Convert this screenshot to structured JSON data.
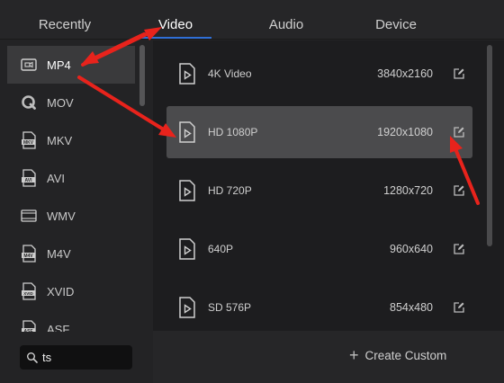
{
  "tabs": [
    {
      "label": "Recently"
    },
    {
      "label": "Video"
    },
    {
      "label": "Audio"
    },
    {
      "label": "Device"
    }
  ],
  "active_tab": "Video",
  "sidebar": {
    "items": [
      {
        "label": "MP4",
        "icon": "mp4-video-icon"
      },
      {
        "label": "MOV",
        "icon": "quicktime-icon"
      },
      {
        "label": "MKV",
        "icon": "mkv-file-icon"
      },
      {
        "label": "AVI",
        "icon": "avi-file-icon"
      },
      {
        "label": "WMV",
        "icon": "wmv-file-icon"
      },
      {
        "label": "M4V",
        "icon": "m4v-file-icon"
      },
      {
        "label": "XVID",
        "icon": "xvid-file-icon"
      },
      {
        "label": "ASF",
        "icon": "asf-file-icon"
      }
    ],
    "selected": "MP4"
  },
  "search": {
    "value": "ts"
  },
  "presets": [
    {
      "name": "4K Video",
      "resolution": "3840x2160"
    },
    {
      "name": "HD 1080P",
      "resolution": "1920x1080"
    },
    {
      "name": "HD 720P",
      "resolution": "1280x720"
    },
    {
      "name": "640P",
      "resolution": "960x640"
    },
    {
      "name": "SD 576P",
      "resolution": "854x480"
    }
  ],
  "selected_preset": "HD 1080P",
  "footer": {
    "create_label": "Create Custom"
  },
  "colors": {
    "accent": "#2f6fd6",
    "annotation_arrow": "#e8231c"
  }
}
